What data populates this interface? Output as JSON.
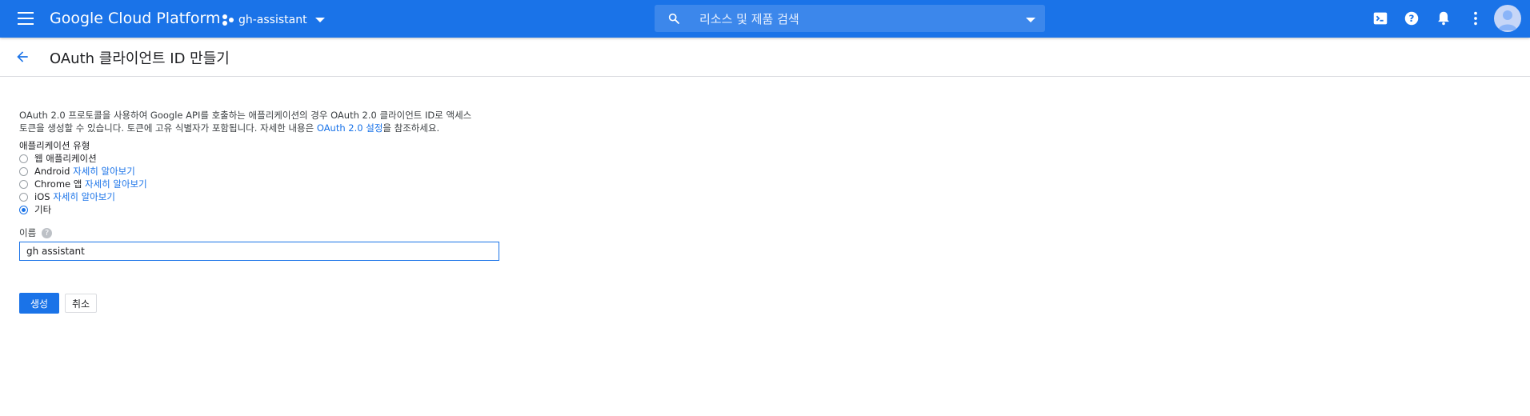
{
  "header": {
    "brand": "Google Cloud Platform",
    "project": "gh-assistant",
    "search_placeholder": "리소스 및 제품 검색"
  },
  "page": {
    "title": "OAuth 클라이언트 ID 만들기"
  },
  "form": {
    "desc_line1": "OAuth 2.0 프로토콜을 사용하여 Google API를 호출하는 애플리케이션의 경우 OAuth 2.0 클라이언트 ID로 액세스",
    "desc_line2_pre": "토큰을 생성할 수 있습니다. 토큰에 고유 식별자가 포함됩니다. 자세한 내용은 ",
    "desc_link": "OAuth 2.0 설정",
    "desc_line2_post": "을 참조하세요.",
    "app_type_label": "애플리케이션 유형",
    "options": [
      {
        "label": "웹 애플리케이션",
        "link": ""
      },
      {
        "label": "Android",
        "link": "자세히 알아보기"
      },
      {
        "label": "Chrome 앱",
        "link": "자세히 알아보기"
      },
      {
        "label": "iOS",
        "link": "자세히 알아보기"
      },
      {
        "label": "기타",
        "link": ""
      }
    ],
    "selected_option": "기타",
    "name_label": "이름",
    "name_value": "gh assistant",
    "create_label": "생성",
    "cancel_label": "취소"
  },
  "colors": {
    "primary": "#1a73e8",
    "topbar": "#1a73e8"
  },
  "icons": [
    "menu-icon",
    "project-icon",
    "search-icon",
    "cloud-shell-icon",
    "help-icon",
    "notifications-icon",
    "more-vert-icon",
    "account-avatar",
    "back-arrow-icon",
    "help-circle-icon"
  ]
}
